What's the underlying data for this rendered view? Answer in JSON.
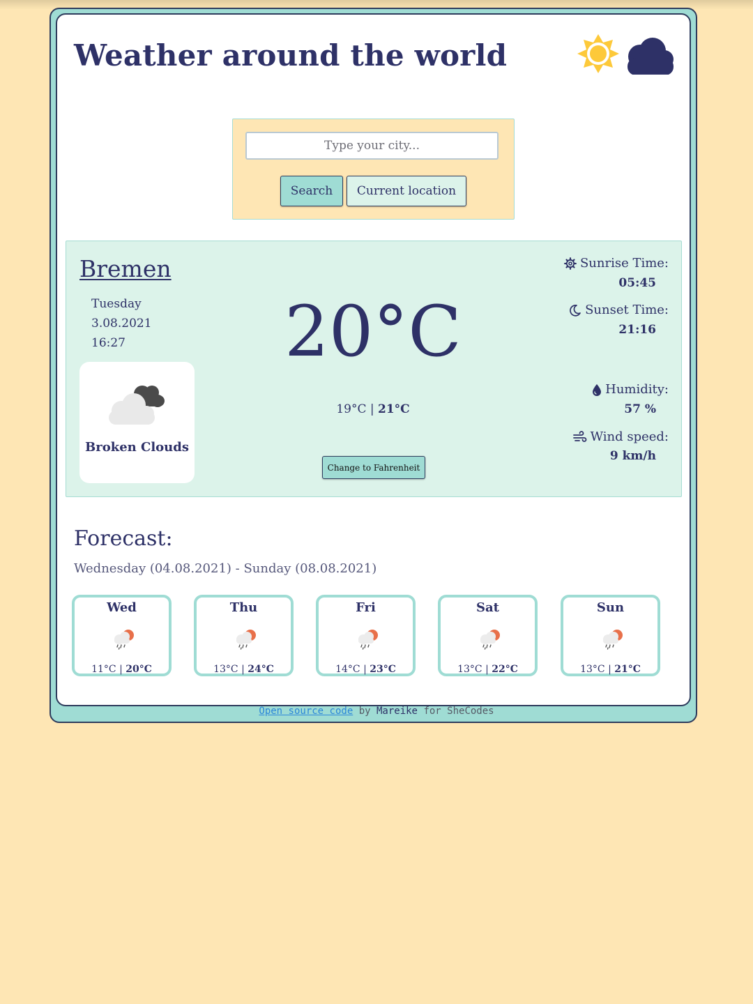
{
  "header": {
    "title": "Weather around the world",
    "icons": [
      "sun-icon",
      "cloud-icon"
    ]
  },
  "search": {
    "placeholder": "Type your city...",
    "value": "",
    "search_label": "Search",
    "location_label": "Current location"
  },
  "current": {
    "city": "Bremen",
    "day": "Tuesday",
    "date": "3.08.2021",
    "time": "16:27",
    "temperature": "20°C",
    "temp_min": "19°C",
    "temp_max": "21°C",
    "description": "Broken Clouds",
    "condition_icon": "broken-clouds-icon",
    "unit_button_label": "Change to Fahrenheit",
    "sunrise_label": "Sunrise Time:",
    "sunrise_value": "05:45",
    "sunset_label": "Sunset Time:",
    "sunset_value": "21:16",
    "humidity_label": "Humidity:",
    "humidity_value": "57 %",
    "wind_label": "Wind speed:",
    "wind_value": "9 km/h"
  },
  "forecast": {
    "title": "Forecast:",
    "range": "Wednesday (04.08.2021) - Sunday (08.08.2021)",
    "days": [
      {
        "day": "Wed",
        "min": "11°C",
        "max": "20°C",
        "icon": "rain-sun-icon"
      },
      {
        "day": "Thu",
        "min": "13°C",
        "max": "24°C",
        "icon": "rain-sun-icon"
      },
      {
        "day": "Fri",
        "min": "14°C",
        "max": "23°C",
        "icon": "rain-sun-icon"
      },
      {
        "day": "Sat",
        "min": "13°C",
        "max": "22°C",
        "icon": "rain-sun-icon"
      },
      {
        "day": "Sun",
        "min": "13°C",
        "max": "21°C",
        "icon": "rain-sun-icon"
      }
    ]
  },
  "footer": {
    "link_text": "Open source code",
    "by": "by",
    "author": "Mareike",
    "suffix": "for SheCodes"
  },
  "colors": {
    "background": "#fee6b4",
    "accent_teal": "#9fdcd4",
    "panel_mint": "#dcf3ea",
    "text_navy": "#2e3167",
    "sun_yellow": "#fdc93a",
    "forecast_sun": "#e8704a"
  }
}
